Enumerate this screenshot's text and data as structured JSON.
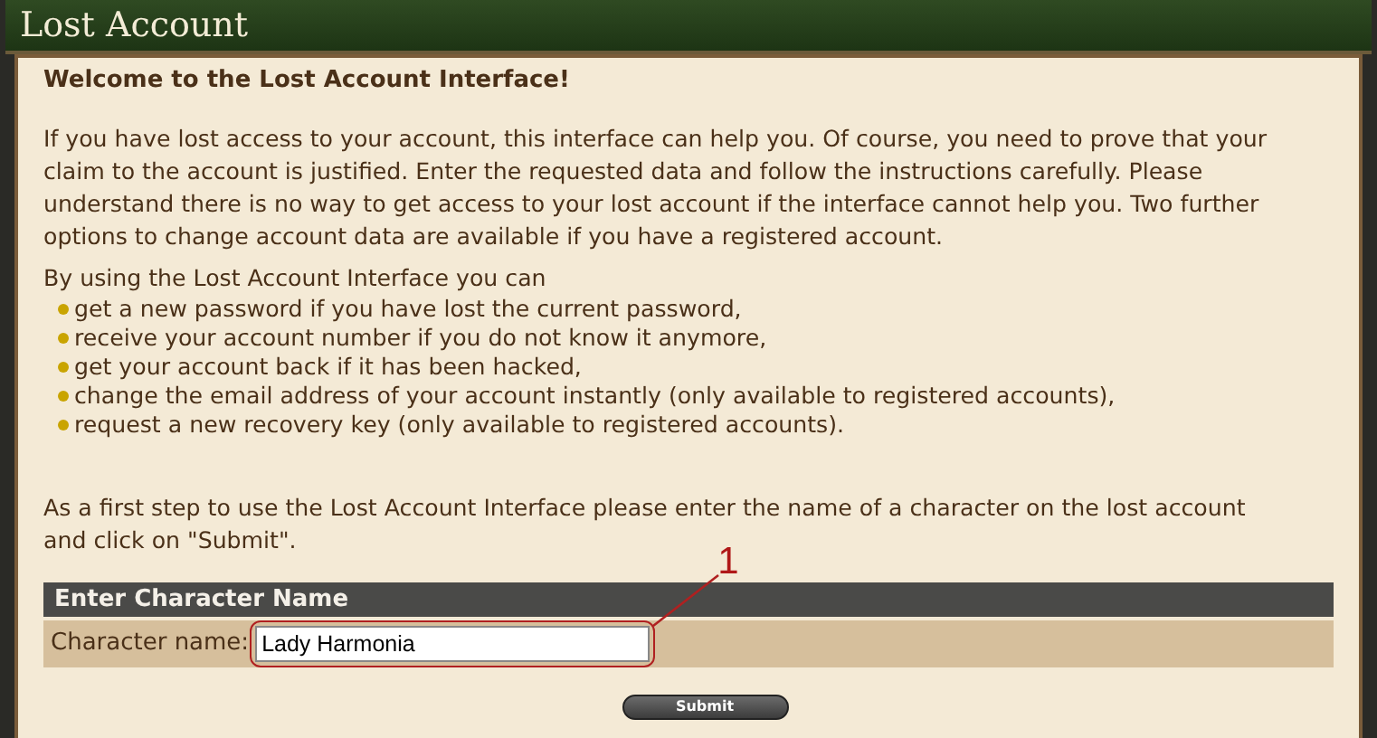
{
  "window": {
    "title": "Lost Account"
  },
  "heading": "Welcome to the Lost Account Interface!",
  "intro": "If you have lost access to your account, this interface can help you. Of course, you need to prove that your claim to the account is justified. Enter the requested data and follow the instructions carefully. Please understand there is no way to get access to your lost account if the interface cannot help you. Two further options to change account data are available if you have a registered account.",
  "list_intro": "By using the Lost Account Interface you can",
  "options": [
    "get a new password if you have lost the current password,",
    "receive your account number if you do not know it anymore,",
    "get your account back if it has been hacked,",
    "change the email address of your account instantly (only available to registered accounts),",
    "request a new recovery key (only available to registered accounts)."
  ],
  "instruction": "As a first step to use the Lost Account Interface please enter the name of a character on the lost account and click on \"Submit\".",
  "form": {
    "title": "Enter Character Name",
    "field_label": "Character name:",
    "value": "Lady Harmonia",
    "button": "Submit"
  },
  "annotation": {
    "label": "1"
  }
}
